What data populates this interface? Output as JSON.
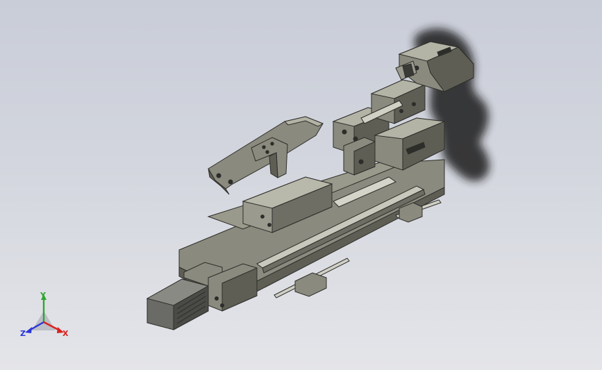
{
  "viewport": {
    "background_top": "#c9cdd8",
    "background_bottom": "#e4e5e9"
  },
  "model": {
    "part_color": "#8a8a7e",
    "part_shadow": "#5e5e55",
    "part_highlight": "#b3b3a6",
    "motor_color": "#6a6a66",
    "shadow_color": "#1b1b1b"
  },
  "triad": {
    "x_label": "X",
    "y_label": "Y",
    "z_label": "Z",
    "x_color": "#d8231f",
    "y_color": "#2fa52f",
    "z_color": "#2a35d8"
  }
}
